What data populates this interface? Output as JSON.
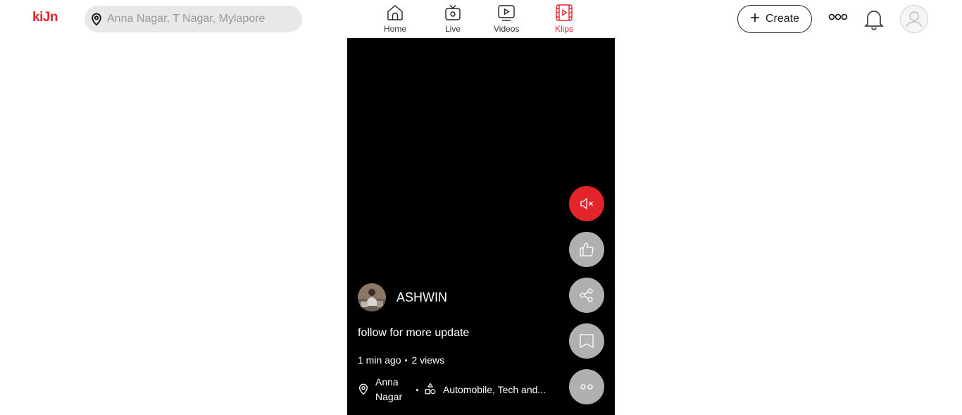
{
  "header": {
    "logo": "kiJn",
    "search": {
      "placeholder": "Anna Nagar, T Nagar, Mylapore",
      "value": ""
    },
    "nav": [
      {
        "label": "Home",
        "icon": "home-icon",
        "active": false
      },
      {
        "label": "Live",
        "icon": "live-tv-icon",
        "active": false
      },
      {
        "label": "Videos",
        "icon": "video-play-icon",
        "active": false
      },
      {
        "label": "Klips",
        "icon": "klips-icon",
        "active": true
      }
    ],
    "create_label": "Create",
    "accent_color": "#e3242b"
  },
  "klip": {
    "creator_name": "ASHWIN",
    "caption": "follow for more update",
    "time_ago": "1 min ago",
    "views": "2 views",
    "location": "Anna Nagar",
    "category": "Automobile, Tech and..."
  },
  "actions": [
    "mute-icon",
    "like-icon",
    "share-icon",
    "bookmark-icon",
    "more-icon"
  ]
}
